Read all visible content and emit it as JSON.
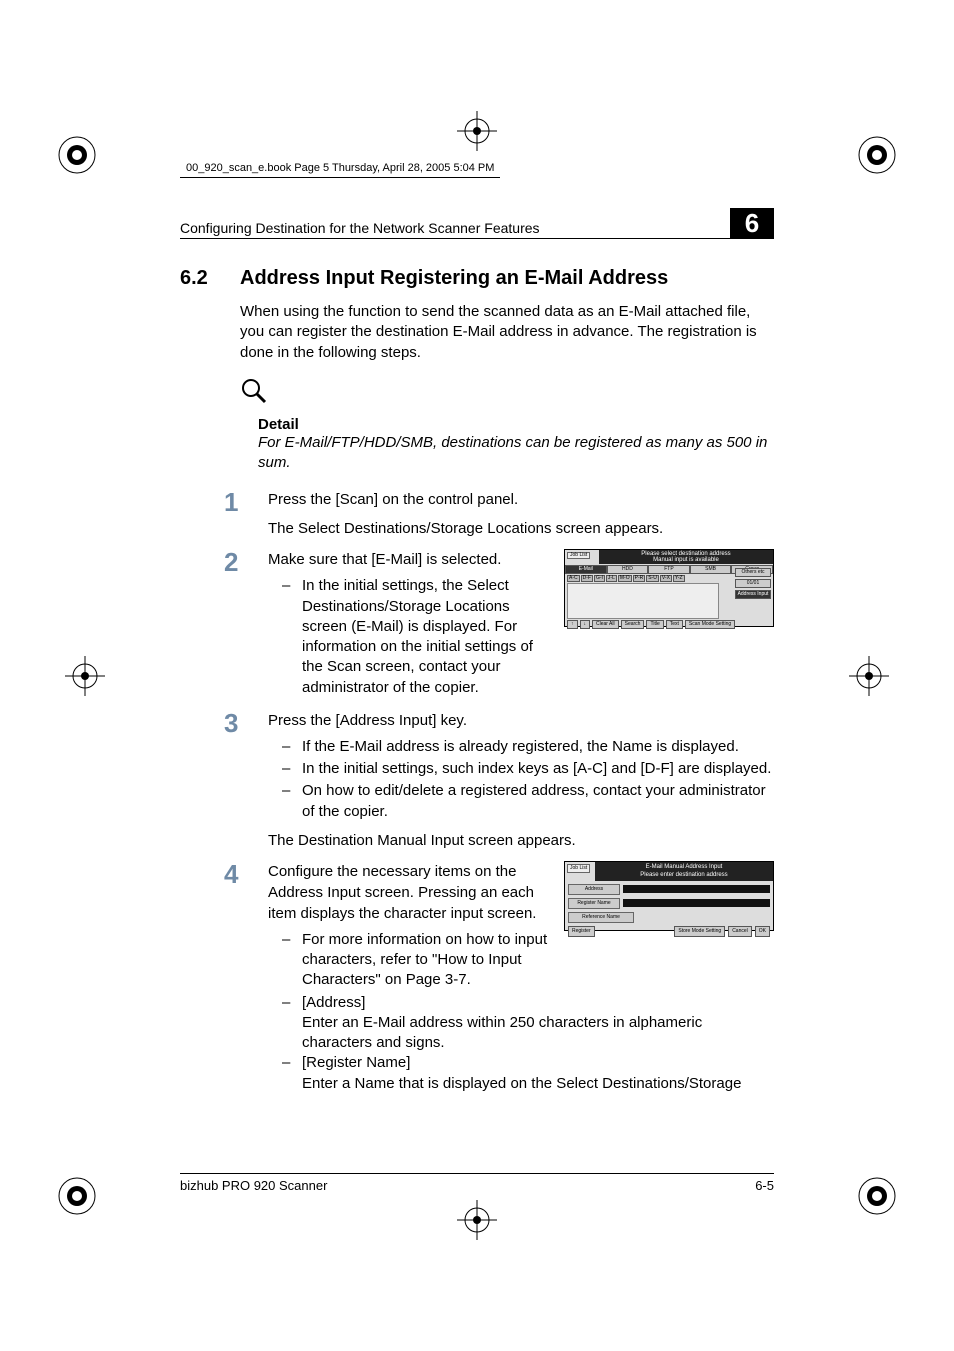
{
  "book_header": "00_920_scan_e.book  Page 5  Thursday, April 28, 2005  5:04 PM",
  "running_head": "Configuring Destination for the Network Scanner Features",
  "chapter_number": "6",
  "section": {
    "number": "6.2",
    "title": "Address Input Registering an E-Mail Address"
  },
  "intro": "When using the function to send the scanned data as an E-Mail attached file, you can register the destination E-Mail address in advance. The registration is done in the following steps.",
  "detail": {
    "label": "Detail",
    "body": "For E-Mail/FTP/HDD/SMB, destinations can be registered as many as 500 in sum."
  },
  "steps": [
    {
      "num": "1",
      "text": "Press the [Scan] on the control panel.",
      "result": "The Select Destinations/Storage Locations screen appears."
    },
    {
      "num": "2",
      "text": "Make sure that [E-Mail] is selected.",
      "bullets": [
        "In the initial settings, the Select Destinations/Storage Locations screen (E-Mail) is displayed. For information on the initial settings of the Scan screen, contact your administrator of the copier."
      ]
    },
    {
      "num": "3",
      "text": "Press the [Address Input] key.",
      "bullets": [
        "If the E-Mail address is already registered, the Name is displayed.",
        "In the initial settings, such index keys as [A-C] and [D-F] are displayed.",
        "On how to edit/delete a registered address, contact your administrator of the copier."
      ],
      "result": "The Destination Manual Input screen appears."
    },
    {
      "num": "4",
      "text": "Configure the necessary items on the Address Input screen. Pressing an each item displays the character input screen.",
      "bullets": [
        "For more information on how to input characters, refer to \"How to Input Characters\" on Page 3-7."
      ],
      "labeled": [
        {
          "label": "[Address]",
          "desc": "Enter an E-Mail address within 250 characters in alphameric characters and signs."
        },
        {
          "label": "[Register Name]",
          "desc": "Enter a Name that is displayed on the Select Destinations/Storage"
        }
      ]
    }
  ],
  "ui1": {
    "joblist": "Job List",
    "title": "Please select destination address\nManual input is available",
    "tabs": [
      "E-Mail",
      "HDD",
      "FTP",
      "SMB",
      "Group"
    ],
    "index_keys": [
      "A-C",
      "D-F",
      "G-I",
      "J-L",
      "M-O",
      "P-R",
      "S-U",
      "V-X",
      "Y-Z"
    ],
    "right": {
      "others": "Others",
      "etc": "etc",
      "page": "01/01",
      "address_input": "Address Input"
    },
    "bottom": {
      "up": "↑",
      "down": "↓",
      "clear_all": "Clear All",
      "search": "Search",
      "title_btn": "Title",
      "text": "Text",
      "scan_mode": "Scan Mode Setting"
    }
  },
  "ui2": {
    "joblist": "Job List",
    "title": "E-Mail Manual Address Input\nPlease enter destination address",
    "address": "Address",
    "register_name": "Register Name",
    "reference_name": "Reference Name",
    "register": "Register",
    "store_mode": "Store Mode Setting",
    "cancel": "Cancel",
    "ok": "OK"
  },
  "footer": {
    "left": "bizhub PRO 920 Scanner",
    "right": "6-5"
  }
}
